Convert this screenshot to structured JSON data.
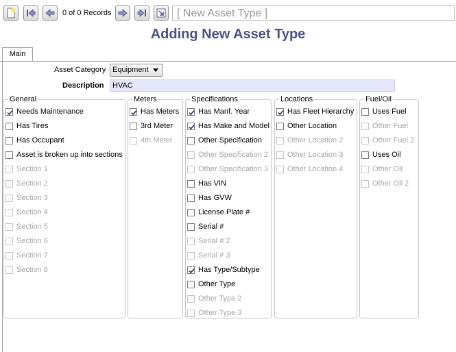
{
  "toolbar": {
    "records_text": "0 of 0 Records",
    "title_field": "[ New Asset Type ]"
  },
  "page_title": "Adding New Asset Type",
  "tabs": [
    {
      "label": "Main"
    }
  ],
  "form": {
    "asset_category_label": "Asset Category",
    "asset_category_value": "Equipment",
    "description_label": "Description",
    "description_value": "HVAC"
  },
  "groups": {
    "general": {
      "title": "General",
      "items": [
        {
          "label": "Needs Maintenance",
          "checked": true,
          "enabled": true
        },
        {
          "label": "Has Tires",
          "checked": false,
          "enabled": true
        },
        {
          "label": "Has Occupant",
          "checked": false,
          "enabled": true
        },
        {
          "label": "Asset is broken up into sections",
          "checked": false,
          "enabled": true
        },
        {
          "label": "Section 1",
          "checked": false,
          "enabled": false
        },
        {
          "label": "Section 2",
          "checked": false,
          "enabled": false
        },
        {
          "label": "Section 3",
          "checked": false,
          "enabled": false
        },
        {
          "label": "Section 4",
          "checked": false,
          "enabled": false
        },
        {
          "label": "Section 5",
          "checked": false,
          "enabled": false
        },
        {
          "label": "Section 6",
          "checked": false,
          "enabled": false
        },
        {
          "label": "Section 7",
          "checked": false,
          "enabled": false
        },
        {
          "label": "Section 8",
          "checked": false,
          "enabled": false
        }
      ]
    },
    "meters": {
      "title": "Meters",
      "items": [
        {
          "label": "Has Meters",
          "checked": true,
          "enabled": true
        },
        {
          "label": "3rd Meter",
          "checked": false,
          "enabled": true
        },
        {
          "label": "4th Meter",
          "checked": false,
          "enabled": false
        }
      ]
    },
    "specifications": {
      "title": "Specifications",
      "items": [
        {
          "label": "Has Manf. Year",
          "checked": true,
          "enabled": true
        },
        {
          "label": "Has Make and Model",
          "checked": true,
          "enabled": true
        },
        {
          "label": "Other Specification",
          "checked": false,
          "enabled": true
        },
        {
          "label": "Other Specification 2",
          "checked": false,
          "enabled": false
        },
        {
          "label": "Other Specification 3",
          "checked": false,
          "enabled": false
        },
        {
          "label": "Has VIN",
          "checked": false,
          "enabled": true
        },
        {
          "label": "Has GVW",
          "checked": false,
          "enabled": true
        },
        {
          "label": "License Plate #",
          "checked": false,
          "enabled": true
        },
        {
          "label": "Serial #",
          "checked": false,
          "enabled": true
        },
        {
          "label": "Serial # 2",
          "checked": false,
          "enabled": false
        },
        {
          "label": "Serial # 3",
          "checked": false,
          "enabled": false
        },
        {
          "label": "Has Type/Subtype",
          "checked": true,
          "enabled": true
        },
        {
          "label": "Other Type",
          "checked": false,
          "enabled": true
        },
        {
          "label": "Other Type 2",
          "checked": false,
          "enabled": false
        },
        {
          "label": "Other Type 3",
          "checked": false,
          "enabled": false
        }
      ]
    },
    "locations": {
      "title": "Locations",
      "items": [
        {
          "label": "Has Fleet Hierarchy",
          "checked": true,
          "enabled": true
        },
        {
          "label": "Other Location",
          "checked": false,
          "enabled": true
        },
        {
          "label": "Other Location 2",
          "checked": false,
          "enabled": false
        },
        {
          "label": "Other Location 3",
          "checked": false,
          "enabled": false
        },
        {
          "label": "Other Location 4",
          "checked": false,
          "enabled": false
        }
      ]
    },
    "fuel_oil": {
      "title": "Fuel/Oil",
      "items": [
        {
          "label": "Uses Fuel",
          "checked": false,
          "enabled": true
        },
        {
          "label": "Other Fuel",
          "checked": false,
          "enabled": false
        },
        {
          "label": "Other Fuel 2",
          "checked": false,
          "enabled": false
        },
        {
          "label": "Uses Oil",
          "checked": false,
          "enabled": true
        },
        {
          "label": "Other Oil",
          "checked": false,
          "enabled": false
        },
        {
          "label": "Other Oil 2",
          "checked": false,
          "enabled": false
        }
      ]
    }
  },
  "colors": {
    "title": "#4b5282",
    "description_bg": "#e6e6fa",
    "disabled_text": "#a6a6a6"
  }
}
